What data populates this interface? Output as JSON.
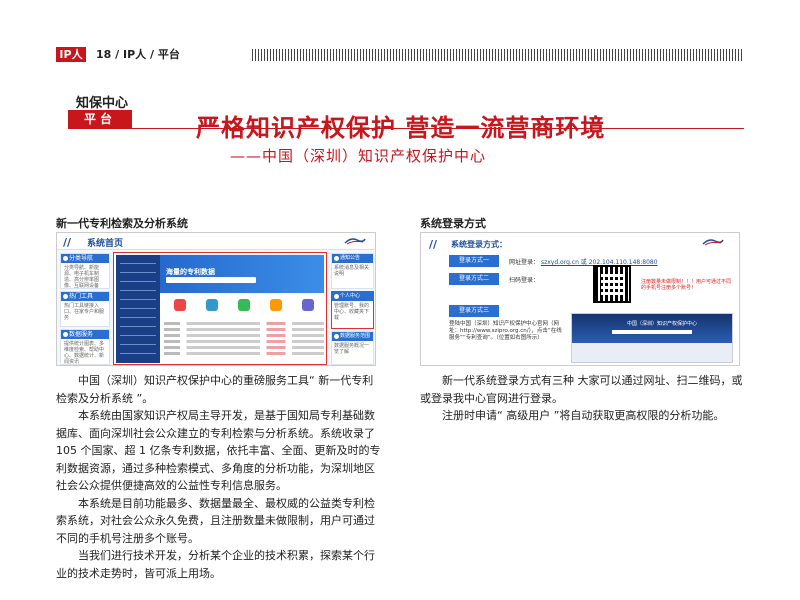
{
  "header": {
    "tag": "IP人",
    "running_text": "18 / IP人 / 平台"
  },
  "section": {
    "title": "知保中心",
    "tag": "平台"
  },
  "headline": "严格知识产权保护  营造一流营商环境",
  "subheadline": "——中国（深圳）知识产权保护中心",
  "left": {
    "heading": "新一代专利检索及分析系统",
    "screenshot": {
      "title": "系统首页",
      "slashes": "//",
      "cards": [
        {
          "label": "分类导航",
          "text": "分类导航、新能源、电子机车制造、高分辨率图像、互联网设备"
        },
        {
          "label": "热门工具",
          "text": "热门工具链接入口、在家专户和服务"
        },
        {
          "label": "数据服务",
          "text": "提供统计图表、多维度检索、帮助中心、数据统计、新闻资讯"
        }
      ],
      "banner": "海量的专利数据",
      "right_cards": [
        {
          "label": "通知公告",
          "text": "系统消息及相关说明"
        },
        {
          "label": "个人中心",
          "text": "管理账号、我的中心、收藏夹下载"
        },
        {
          "label": "数据服务范围",
          "text": "数据服务概况一览了解"
        }
      ]
    },
    "paragraphs": [
      "中国（深圳）知识产权保护中心的重磅服务工具“ 新一代专利检索及分析系统 ”。",
      "本系统由国家知识产权局主导开发，是基于国知局专利基础数据库、面向深圳社会公众建立的专利检索与分析系统。系统收录了 105 个国家、超 1 亿条专利数据，依托丰富、全面、更新及时的专利数据资源，通过多种检索模式、多角度的分析功能，为深圳地区社会公众提供便捷高效的公益性专利信息服务。",
      "本系统是目前功能最多、数据量最全、最权威的公益类专利检索系统，对社会公众永久免费，且注册数量未做限制，用户可通过不同的手机号注册多个账号。",
      "当我们进行技术开发，分析某个企业的技术积累，探索某个行业的技术走势时，皆可派上用场。"
    ]
  },
  "right": {
    "heading": "系统登录方式",
    "screenshot": {
      "title": "系统登录方式：",
      "slashes": "//",
      "methods": [
        {
          "button": "登录方式一",
          "label": "网址登录：",
          "value": "szxyd.org.cn 或 202.104.110.148:8080"
        },
        {
          "button": "登录方式二",
          "label": "扫码登录：",
          "value": ""
        },
        {
          "button": "登录方式三",
          "label": "",
          "value": ""
        }
      ],
      "warning": "注册数量未做限制！！！用户可通过不同的手机号注册多个账号！",
      "caption": "登陆中国（深圳）知识产权保护中心官网（网址：http://www.szipro.org.cn/），点击“在线服务”“专利查询”。（位置如右图所示）",
      "website_title": "中国（深圳）知识产权保护中心"
    },
    "paragraphs": [
      "新一代系统登录方式有三种 大家可以通过网址、扫二维码，或或登录我中心官网进行登录。",
      "注册时申请“ 高级用户 ”将自动获取更高权限的分析功能。"
    ]
  },
  "colors": {
    "accent_red": "#c8161d",
    "system_blue": "#2a6ed1"
  }
}
